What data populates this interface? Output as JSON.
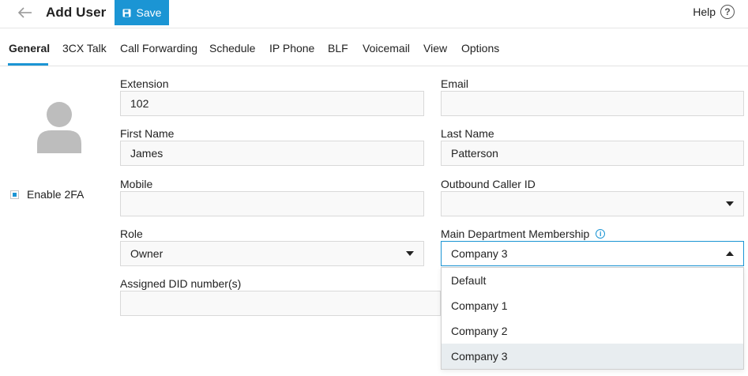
{
  "header": {
    "title": "Add User",
    "save_label": "Save",
    "help_label": "Help"
  },
  "tabs": [
    {
      "label": "General",
      "active": true
    },
    {
      "label": "3CX Talk"
    },
    {
      "label": "Call Forwarding"
    },
    {
      "label": "Schedule"
    },
    {
      "label": "IP Phone"
    },
    {
      "label": "BLF"
    },
    {
      "label": "Voicemail"
    },
    {
      "label": "View"
    },
    {
      "label": "Options"
    }
  ],
  "left_panel": {
    "twofa_label": "Enable 2FA",
    "twofa_checked": true
  },
  "form": {
    "extension": {
      "label": "Extension",
      "value": "102"
    },
    "email": {
      "label": "Email",
      "value": ""
    },
    "first_name": {
      "label": "First Name",
      "value": "James"
    },
    "last_name": {
      "label": "Last Name",
      "value": "Patterson"
    },
    "mobile": {
      "label": "Mobile",
      "value": ""
    },
    "outbound_caller_id": {
      "label": "Outbound Caller ID",
      "value": ""
    },
    "role": {
      "label": "Role",
      "value": "Owner"
    },
    "main_department": {
      "label": "Main Department Membership",
      "value": "Company 3"
    },
    "assigned_did": {
      "label": "Assigned DID number(s)",
      "value": ""
    }
  },
  "department_options": [
    {
      "label": "Default"
    },
    {
      "label": "Company 1"
    },
    {
      "label": "Company 2"
    },
    {
      "label": "Company 3",
      "selected": true
    }
  ],
  "colors": {
    "accent": "#1b95d4",
    "selected_option_bg": "#e8edf0",
    "field_bg": "#f9f9f9",
    "avatar": "#bdbdbd"
  }
}
